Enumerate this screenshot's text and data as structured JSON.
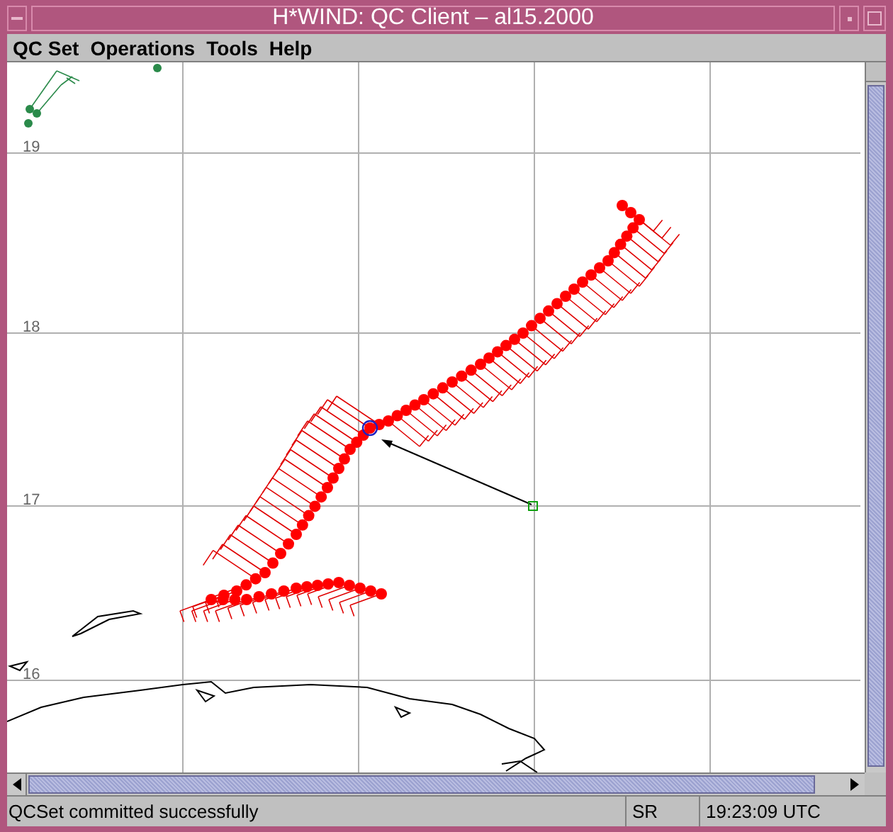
{
  "window": {
    "title": "H*WIND: QC Client – al15.2000"
  },
  "menu": [
    {
      "label": "QC Set"
    },
    {
      "label": "Operations"
    },
    {
      "label": "Tools"
    },
    {
      "label": "Help"
    }
  ],
  "map": {
    "latitude_labels": [
      "19",
      "18",
      "17",
      "16"
    ]
  },
  "status_bar": {
    "message": "QCSet committed successfully",
    "mode": "SR",
    "time": "19:23:09 UTC"
  }
}
